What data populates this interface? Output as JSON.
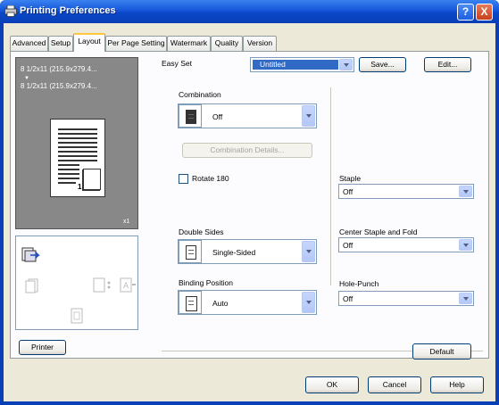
{
  "window": {
    "title": "Printing Preferences",
    "help_glyph": "?",
    "close_glyph": "X"
  },
  "tabs": [
    {
      "label": "Advanced"
    },
    {
      "label": "Setup"
    },
    {
      "label": "Layout"
    },
    {
      "label": "Per Page Setting"
    },
    {
      "label": "Watermark"
    },
    {
      "label": "Quality"
    },
    {
      "label": "Version"
    }
  ],
  "active_tab": "Layout",
  "preview": {
    "line1": "8 1/2x11 (215.9x279.4...",
    "line2": "8 1/2x11 (215.9x279.4...",
    "arrow": "▼",
    "page_number": "1",
    "copies": "x1"
  },
  "printer_button": "Printer",
  "easy_set": {
    "label": "Easy Set",
    "value": "Untitled",
    "save": "Save...",
    "edit": "Edit..."
  },
  "combination": {
    "label": "Combination",
    "value": "Off",
    "details_button": "Combination Details..."
  },
  "rotate180": {
    "label": "Rotate 180",
    "checked": false
  },
  "double_sides": {
    "label": "Double Sides",
    "value": "Single-Sided"
  },
  "binding_position": {
    "label": "Binding Position",
    "value": "Auto"
  },
  "staple": {
    "label": "Staple",
    "value": "Off"
  },
  "center_staple": {
    "label": "Center Staple and Fold",
    "value": "Off"
  },
  "hole_punch": {
    "label": "Hole-Punch",
    "value": "Off"
  },
  "default_button": "Default",
  "footer": {
    "ok": "OK",
    "cancel": "Cancel",
    "help": "Help"
  },
  "colors": {
    "title_bar": "#0a3fb8",
    "dialog_bg": "#ece9d8",
    "panel_bg": "#fcfcfe",
    "preview_bg": "#888888",
    "easy_set_selected": "#316ac5"
  }
}
